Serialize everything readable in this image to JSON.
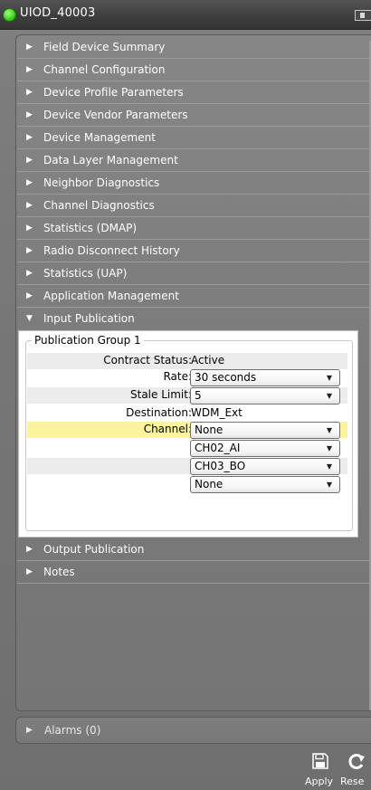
{
  "window": {
    "title": "UIOD_40003",
    "status_color": "#39d11c"
  },
  "sections_top": [
    {
      "label": "Field Device Summary"
    },
    {
      "label": "Channel Configuration"
    },
    {
      "label": "Device Profile Parameters"
    },
    {
      "label": "Device Vendor Parameters"
    },
    {
      "label": "Device Management"
    },
    {
      "label": "Data Layer Management"
    },
    {
      "label": "Neighbor Diagnostics"
    },
    {
      "label": "Channel Diagnostics"
    },
    {
      "label": "Statistics (DMAP)"
    },
    {
      "label": "Radio Disconnect History"
    },
    {
      "label": "Statistics (UAP)"
    },
    {
      "label": "Application Management"
    }
  ],
  "input_publication": {
    "label": "Input Publication",
    "expanded": true,
    "group_title": "Publication Group 1",
    "rows": {
      "contract_status_label": "Contract Status:",
      "contract_status_value": "Active",
      "rate_label": "Rate:",
      "rate_value": "30 seconds",
      "stale_limit_label": "Stale Limit:",
      "stale_limit_value": "5",
      "destination_label": "Destination:",
      "destination_value": "WDM_Ext",
      "channel_label": "Channel:",
      "channel_values": [
        "None",
        "CH02_AI",
        "CH03_BO",
        "None"
      ]
    }
  },
  "sections_bottom": [
    {
      "label": "Output Publication"
    },
    {
      "label": "Notes"
    }
  ],
  "alarms": {
    "label": "Alarms (0)"
  },
  "toolbar": {
    "apply_label": "Apply",
    "reset_label": "Rese"
  },
  "icons": {
    "section_collapsed": "triangle-right-icon",
    "section_expanded": "triangle-down-icon",
    "dropdown": "chevron-down-icon",
    "apply": "save-icon",
    "reset": "refresh-icon"
  },
  "colors": {
    "highlight_row": "#fbf49a",
    "alt_row": "#ebebeb"
  }
}
